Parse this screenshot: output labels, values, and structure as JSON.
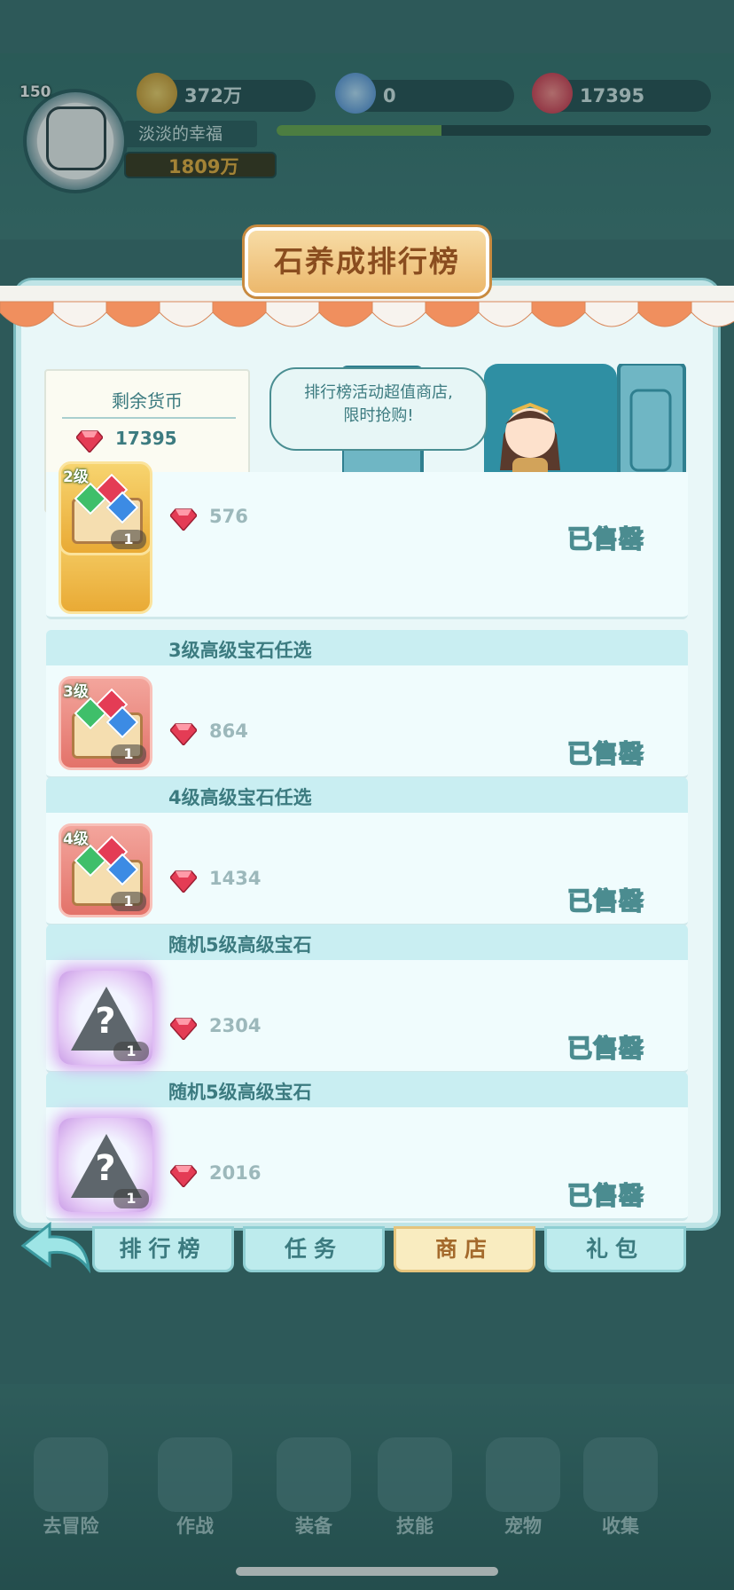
{
  "hud": {
    "level": "150",
    "coins": "372万",
    "diamonds": "0",
    "gems": "17395",
    "player_name": "淡淡的幸福",
    "power": "1809万",
    "xp_progress": 0.38
  },
  "dialog": {
    "title": "石养成排行榜",
    "currency_label": "剩余货币",
    "currency_value": "17395",
    "speech": [
      "排行榜活动超值商店,",
      "限时抢购!"
    ]
  },
  "shop_items": [
    {
      "name": "",
      "level_badge": "2级",
      "price": "576",
      "count": "1",
      "status": "已售罄"
    },
    {
      "name": "3级高级宝石任选",
      "level_badge": "3级",
      "price": "864",
      "count": "1",
      "status": "已售罄"
    },
    {
      "name": "4级高级宝石任选",
      "level_badge": "4级",
      "price": "1434",
      "count": "1",
      "status": "已售罄"
    },
    {
      "name": "随机5级高级宝石",
      "level_badge": "",
      "price": "2304",
      "count": "1",
      "status": "已售罄"
    },
    {
      "name": "随机5级高级宝石",
      "level_badge": "",
      "price": "2016",
      "count": "1",
      "status": "已售罄"
    }
  ],
  "tabs": [
    "排行榜",
    "任务",
    "商店",
    "礼包"
  ],
  "active_tab": "商店",
  "bottom_nav": [
    "去冒险",
    "作战",
    "装备",
    "技能",
    "宠物",
    "收集"
  ],
  "colors": {
    "accent": "#3c7b80",
    "ruby": "#e43c55",
    "active_tab": "#f9ecc0"
  }
}
